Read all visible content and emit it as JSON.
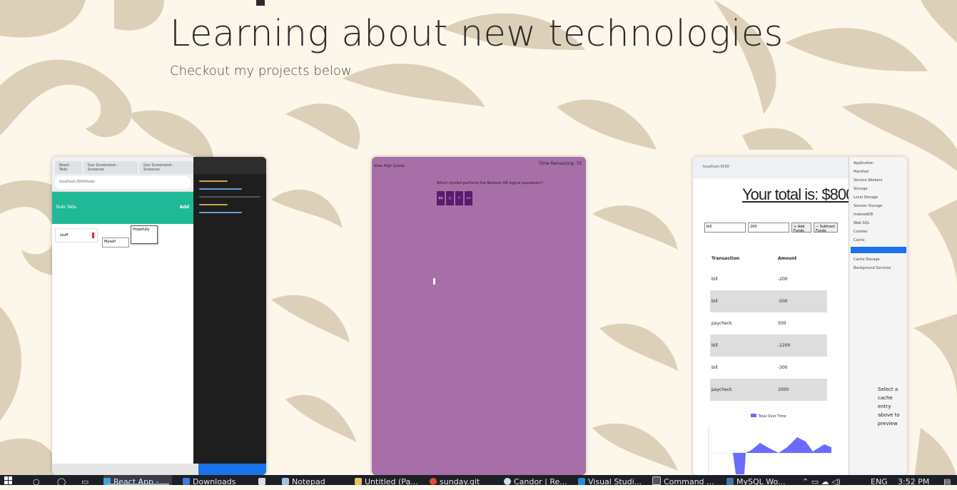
{
  "hero": {
    "title": "Learning about new technologies",
    "subtitle": "Checkout my projects below"
  },
  "projects": [
    {
      "name": "todo-app",
      "tabs": [
        "React Todo",
        "Gov Screenshot - Screenso",
        "Gov Screenshot - Screenso"
      ],
      "url": "localhost:3000/todo",
      "header_title": "Todo Tabs",
      "header_right": "Add",
      "item": "stuff",
      "input_value": "Myself",
      "popup_value": "Hopefully"
    },
    {
      "name": "quiz-app",
      "title": "View High Scores",
      "timer": "Time Remaining: 75",
      "question": "Which symbol performs the Boolean OR logical expression?",
      "answers": [
        "&&",
        "||",
        "!!",
        "<>"
      ]
    },
    {
      "name": "budget-tracker",
      "url": "localhost:3000",
      "total": "Your total is: $800",
      "form": {
        "name": "bill",
        "amount": "200",
        "add": "+ Add Funds",
        "sub": "− Subtract Funds"
      },
      "table_headers": [
        "Transaction",
        "Amount"
      ],
      "rows": [
        [
          "bill",
          "-200"
        ],
        [
          "bill",
          "-500"
        ],
        [
          "paycheck",
          "500"
        ],
        [
          "bill",
          "-2200"
        ],
        [
          "bill",
          "-300"
        ],
        [
          "paycheck",
          "1000"
        ]
      ],
      "chart_label": "Total Over Time",
      "devtools_preview": "Select a cache entry above to preview",
      "devtools_items": [
        "Application",
        "Manifest",
        "Service Workers",
        "Storage",
        "Local Storage",
        "Session Storage",
        "IndexedDB",
        "Web SQL",
        "Cookies",
        "Cache",
        "Cache Storage",
        "Background Services"
      ]
    }
  ],
  "taskbar": {
    "items": [
      "React App - ...",
      "Downloads",
      "",
      "Notepad",
      "Untitled (Pa...",
      "sunday.git",
      "Candor | Re...",
      "Visual Studi...",
      "Command ...",
      "MySQL Wo..."
    ],
    "tray_lang": "ENG",
    "clock": "3:52 PM"
  },
  "colors": {
    "background": "#fdf6ea",
    "pattern": "#ddd0b8",
    "quiz_purple": "#a86ea8",
    "todo_green": "#20b997",
    "taskbar": "#1d1f26"
  }
}
